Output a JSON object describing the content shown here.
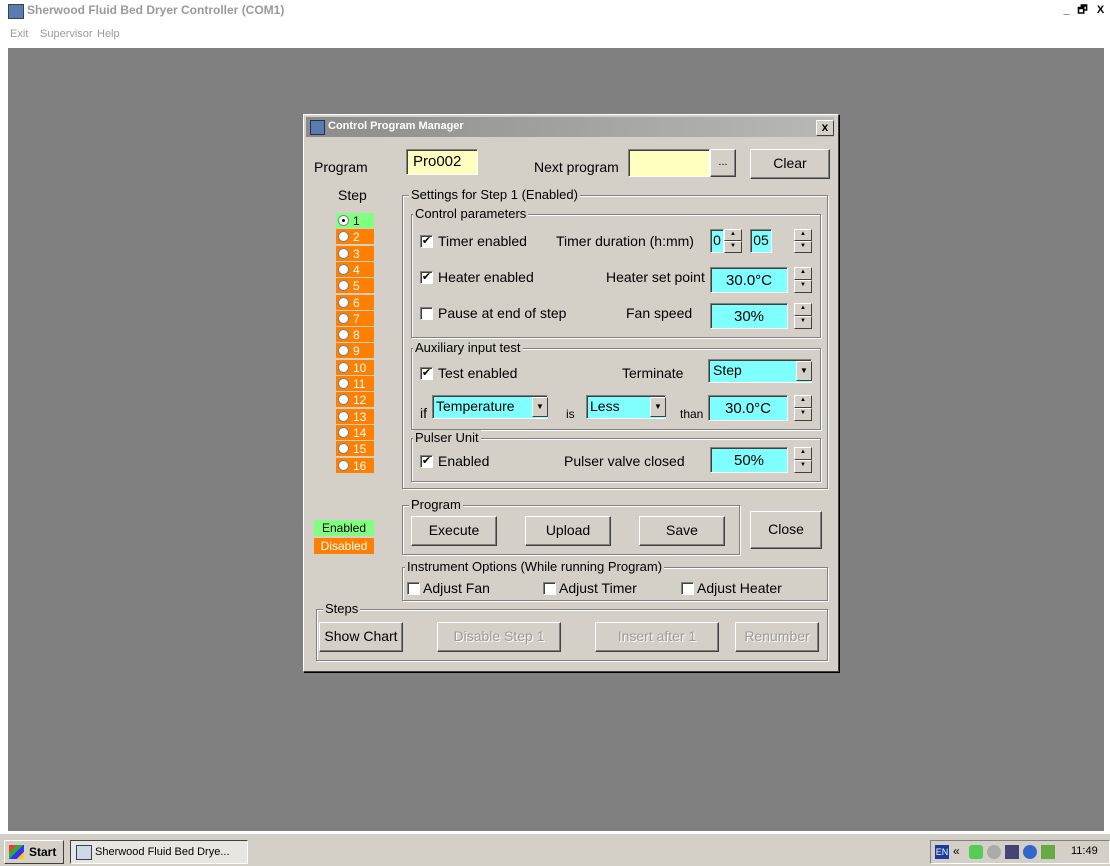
{
  "window": {
    "title": "Sherwood Fluid Bed Dryer Controller (COM1)",
    "caption_buttons": [
      "_",
      "🗗",
      "X"
    ]
  },
  "menu": [
    "Exit",
    "Supervisor",
    "Help"
  ],
  "taskbar": {
    "start": "Start",
    "task": "Sherwood Fluid Bed Drye...",
    "lang": "EN",
    "chevron": "«",
    "clock": "11:49"
  },
  "dialog": {
    "title": "Control Program Manager",
    "close": "x",
    "program_label": "Program",
    "program_value": "Pro002",
    "next_program_label": "Next program",
    "next_program_value": "",
    "browse_label": "...",
    "clear_label": "Clear",
    "step_label": "Step",
    "steps": [
      "1",
      "2",
      "3",
      "4",
      "5",
      "6",
      "7",
      "8",
      "9",
      "10",
      "11",
      "12",
      "13",
      "14",
      "15",
      "16"
    ],
    "selected_step": "1",
    "legend_enabled": "Enabled",
    "legend_disabled": "Disabled",
    "colors": {
      "enabled": "#80ff80",
      "disabled": "#ff8000",
      "field": "#80ffff",
      "program_field": "#ffffc0"
    },
    "settings": {
      "title": "Settings for Step 1 (Enabled)",
      "control": {
        "title": "Control parameters",
        "timer_enabled": "Timer enabled",
        "timer_enabled_checked": true,
        "timer_duration_label": "Timer duration (h:mm)",
        "timer_hours": "0",
        "timer_minutes": "05",
        "heater_enabled": "Heater enabled",
        "heater_enabled_checked": true,
        "heater_setpoint_label": "Heater set point",
        "heater_setpoint": "30.0°C",
        "pause": "Pause at end of step",
        "pause_checked": false,
        "fan_speed_label": "Fan speed",
        "fan_speed": "30%"
      },
      "aux": {
        "title": "Auxiliary input test",
        "test_enabled": "Test enabled",
        "test_enabled_checked": true,
        "terminate_label": "Terminate",
        "terminate_value": "Step",
        "if_label": "if",
        "input_value": "Temperature",
        "is_label": "is",
        "compare_value": "Less",
        "than_label": "than",
        "threshold": "30.0°C"
      },
      "pulser": {
        "title": "Pulser Unit",
        "enabled": "Enabled",
        "enabled_checked": true,
        "valve_label": "Pulser valve closed",
        "valve_value": "50%"
      }
    },
    "program_group": {
      "title": "Program",
      "execute": "Execute",
      "upload": "Upload",
      "save": "Save"
    },
    "close_button": "Close",
    "instrument": {
      "title": "Instrument Options (While running Program)",
      "fan": "Adjust Fan",
      "timer": "Adjust Timer",
      "heater": "Adjust Heater"
    },
    "steps_group": {
      "title": "Steps",
      "show_chart": "Show Chart",
      "disable": "Disable Step 1",
      "insert": "Insert after 1",
      "renumber": "Renumber"
    }
  }
}
